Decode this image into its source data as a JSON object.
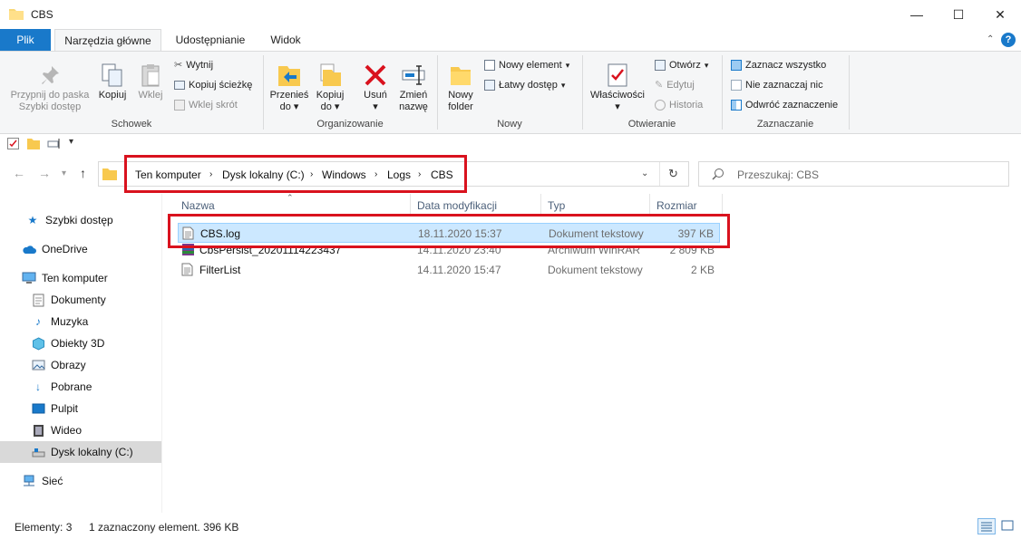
{
  "window": {
    "title": "CBS",
    "minimize": "—",
    "maximize": "☐",
    "close": "✕"
  },
  "tabs": [
    {
      "label": "Plik"
    },
    {
      "label": "Narzędzia główne"
    },
    {
      "label": "Udostępnianie"
    },
    {
      "label": "Widok"
    }
  ],
  "ribbon": {
    "clipboard": {
      "pin_label_1": "Przypnij do paska",
      "pin_label_2": "Szybki dostęp",
      "copy": "Kopiuj",
      "paste": "Wklej",
      "cut": "Wytnij",
      "copy_path": "Kopiuj ścieżkę",
      "paste_shortcut": "Wklej skrót",
      "group": "Schowek"
    },
    "organize": {
      "move_1": "Przenieś",
      "move_2": "do",
      "copyto_1": "Kopiuj",
      "copyto_2": "do",
      "delete": "Usuń",
      "rename_1": "Zmień",
      "rename_2": "nazwę",
      "group": "Organizowanie"
    },
    "new": {
      "folder_1": "Nowy",
      "folder_2": "folder",
      "new_item": "Nowy element",
      "easy_access": "Łatwy dostęp",
      "group": "Nowy"
    },
    "open": {
      "properties": "Właściwości",
      "open": "Otwórz",
      "edit": "Edytuj",
      "history": "Historia",
      "group": "Otwieranie"
    },
    "select": {
      "select_all": "Zaznacz wszystko",
      "select_none": "Nie zaznaczaj nic",
      "invert": "Odwróć zaznaczenie",
      "group": "Zaznaczanie"
    }
  },
  "address": {
    "crumbs": [
      "Ten komputer",
      "Dysk lokalny (C:)",
      "Windows",
      "Logs",
      "CBS"
    ],
    "search_placeholder": "Przeszukaj: CBS"
  },
  "nav": [
    {
      "label": "Szybki dostęp",
      "icon": "star-icon"
    },
    {
      "label": "OneDrive",
      "icon": "cloud-icon"
    },
    {
      "label": "Ten komputer",
      "icon": "computer-icon"
    },
    {
      "label": "Dokumenty",
      "icon": "documents-icon"
    },
    {
      "label": "Muzyka",
      "icon": "music-icon"
    },
    {
      "label": "Obiekty 3D",
      "icon": "3d-objects-icon"
    },
    {
      "label": "Obrazy",
      "icon": "pictures-icon"
    },
    {
      "label": "Pobrane",
      "icon": "downloads-icon"
    },
    {
      "label": "Pulpit",
      "icon": "desktop-icon"
    },
    {
      "label": "Wideo",
      "icon": "video-icon"
    },
    {
      "label": "Dysk lokalny (C:)",
      "icon": "drive-icon"
    },
    {
      "label": "Sieć",
      "icon": "network-icon"
    }
  ],
  "columns": {
    "name": "Nazwa",
    "modified": "Data modyfikacji",
    "type": "Typ",
    "size": "Rozmiar"
  },
  "files": [
    {
      "name": "CBS.log",
      "modified": "18.11.2020 15:37",
      "type": "Dokument tekstowy",
      "size": "397 KB"
    },
    {
      "name": "CbsPersist_20201114223437",
      "modified": "14.11.2020 23:40",
      "type": "Archiwum WinRAR",
      "size": "2 809 KB"
    },
    {
      "name": "FilterList",
      "modified": "14.11.2020 15:47",
      "type": "Dokument tekstowy",
      "size": "2 KB"
    }
  ],
  "status": {
    "count": "Elementy: 3",
    "selection": "1 zaznaczony element. 396 KB"
  },
  "colors": {
    "accent": "#1979ca",
    "highlight": "#d9121e",
    "selection": "#cce8ff"
  }
}
